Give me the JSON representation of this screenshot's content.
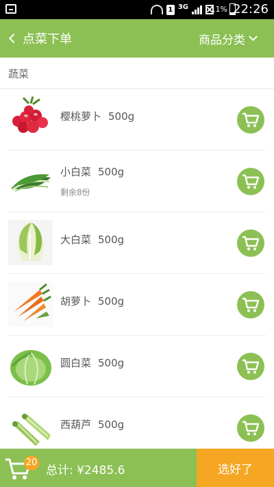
{
  "status": {
    "battery": "11%",
    "time": "22:26",
    "network": "3G",
    "sim": "1"
  },
  "header": {
    "back_label": "点菜下单",
    "category_label": "商品分类"
  },
  "section": {
    "title": "蔬菜"
  },
  "items": [
    {
      "name": "樱桃萝卜",
      "weight": "500g",
      "sub": "",
      "image": "radish"
    },
    {
      "name": "小白菜",
      "weight": "500g",
      "sub": "剩余8份",
      "image": "bok-choy"
    },
    {
      "name": "大白菜",
      "weight": "500g",
      "sub": "",
      "image": "napa-cabbage"
    },
    {
      "name": "胡萝卜",
      "weight": "500g",
      "sub": "",
      "image": "carrot"
    },
    {
      "name": "圆白菜",
      "weight": "500g",
      "sub": "",
      "image": "cabbage"
    },
    {
      "name": "西葫芦",
      "weight": "500g",
      "sub": "",
      "image": "zucchini"
    }
  ],
  "bottom": {
    "cart_count": "20",
    "total": "总计: ¥2485.6",
    "done_label": "选好了"
  },
  "colors": {
    "accent": "#8cc054",
    "action": "#f5a623"
  }
}
